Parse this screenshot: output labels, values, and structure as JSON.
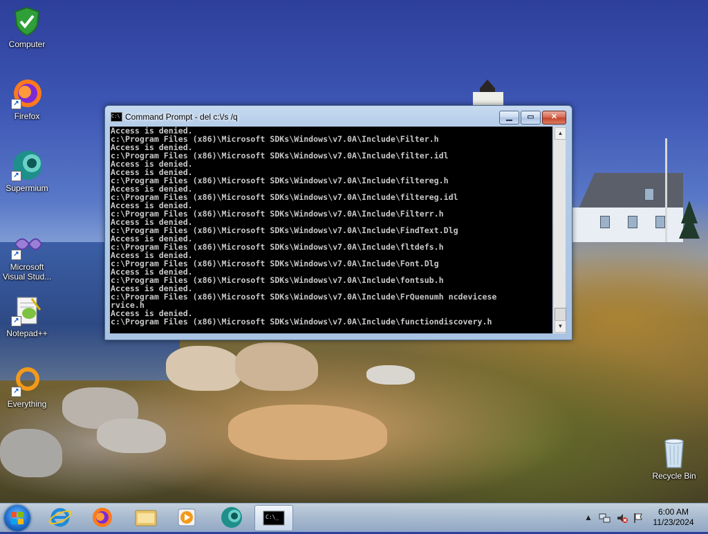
{
  "desktop": {
    "icons": [
      {
        "label": "Computer",
        "icon": "shield-check-icon"
      },
      {
        "label": "Firefox",
        "icon": "firefox-icon"
      },
      {
        "label": "Supermium",
        "icon": "supermium-icon"
      },
      {
        "label": "Microsoft Visual Stud...",
        "icon": "visual-studio-icon"
      },
      {
        "label": "Notepad++",
        "icon": "notepadpp-icon"
      },
      {
        "label": "Everything",
        "icon": "everything-icon"
      },
      {
        "label": "Recycle Bin",
        "icon": "recycle-bin-icon"
      }
    ]
  },
  "window": {
    "title": "Command Prompt - del  c:\\/s /q",
    "buttons": {
      "minimize": "▁",
      "maximize": "▭",
      "close": "✕"
    },
    "console_lines": [
      "Access is denied.",
      "c:\\Program Files (x86)\\Microsoft SDKs\\Windows\\v7.0A\\Include\\Filter.h",
      "Access is denied.",
      "c:\\Program Files (x86)\\Microsoft SDKs\\Windows\\v7.0A\\Include\\filter.idl",
      "Access is denied.",
      "Access is denied.",
      "c:\\Program Files (x86)\\Microsoft SDKs\\Windows\\v7.0A\\Include\\filtereg.h",
      "Access is denied.",
      "c:\\Program Files (x86)\\Microsoft SDKs\\Windows\\v7.0A\\Include\\filtereg.idl",
      "Access is denied.",
      "c:\\Program Files (x86)\\Microsoft SDKs\\Windows\\v7.0A\\Include\\Filterr.h",
      "Access is denied.",
      "c:\\Program Files (x86)\\Microsoft SDKs\\Windows\\v7.0A\\Include\\FindText.Dlg",
      "Access is denied.",
      "c:\\Program Files (x86)\\Microsoft SDKs\\Windows\\v7.0A\\Include\\fltdefs.h",
      "Access is denied.",
      "c:\\Program Files (x86)\\Microsoft SDKs\\Windows\\v7.0A\\Include\\Font.Dlg",
      "Access is denied.",
      "c:\\Program Files (x86)\\Microsoft SDKs\\Windows\\v7.0A\\Include\\fontsub.h",
      "Access is denied.",
      "c:\\Program Files (x86)\\Microsoft SDKs\\Windows\\v7.0A\\Include\\FrQuenumh ncdevicese",
      "rvice.h",
      "Access is denied.",
      "c:\\Program Files (x86)\\Microsoft SDKs\\Windows\\v7.0A\\Include\\functiondiscovery.h"
    ]
  },
  "taskbar": {
    "items": [
      "internet-explorer-icon",
      "firefox-icon",
      "file-explorer-icon",
      "media-player-icon",
      "supermium-icon",
      "command-prompt-icon"
    ],
    "clock_time": "6:00 AM",
    "clock_date": "11/23/2024",
    "tray_icons": [
      "show-hidden-icons-arrow-icon",
      "network-icon",
      "volume-muted-icon",
      "action-center-flag-icon"
    ]
  },
  "colors": {
    "console_bg": "#000000",
    "console_fg": "#c8c8c8",
    "accent": "#1e6fcf"
  }
}
